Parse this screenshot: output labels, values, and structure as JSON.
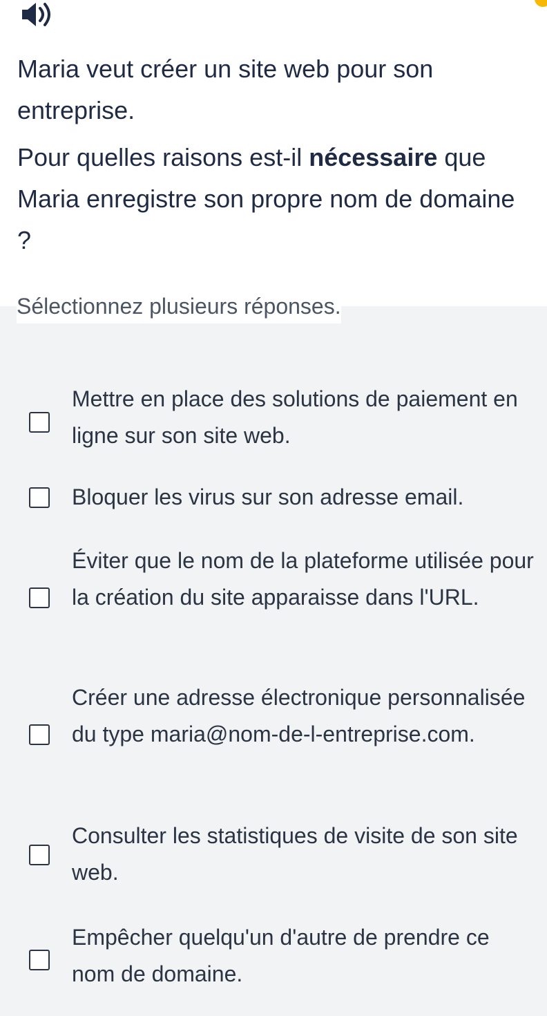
{
  "question": {
    "line1": "Maria veut créer un site web pour son entreprise.",
    "line2_before": "Pour quelles raisons est-il ",
    "line2_strong": "nécessaire",
    "line2_after": " que Maria enregistre son propre nom de domaine ?"
  },
  "instructions": "Sélectionnez plusieurs réponses.",
  "options": [
    {
      "label": "Mettre en place des solutions de paiement en ligne sur son site web.",
      "checked": false
    },
    {
      "label": "Bloquer les virus sur son adresse email.",
      "checked": false
    },
    {
      "label": "Éviter que le nom de la plateforme utilisée pour la création du site apparaisse dans l'URL.",
      "checked": false
    },
    {
      "label": "Créer une adresse électronique personnalisée du type maria@nom-de-l-entreprise.com.",
      "checked": false
    },
    {
      "label": "Consulter les statistiques de visite de son site web.",
      "checked": false
    },
    {
      "label": "Empêcher quelqu'un d'autre de prendre ce nom de domaine.",
      "checked": false
    }
  ],
  "icons": {
    "audio": "speaker-icon"
  },
  "colors": {
    "text": "#1f2a44",
    "answers_background": "#f1f3f5",
    "corner_badge": "#f6b800"
  }
}
